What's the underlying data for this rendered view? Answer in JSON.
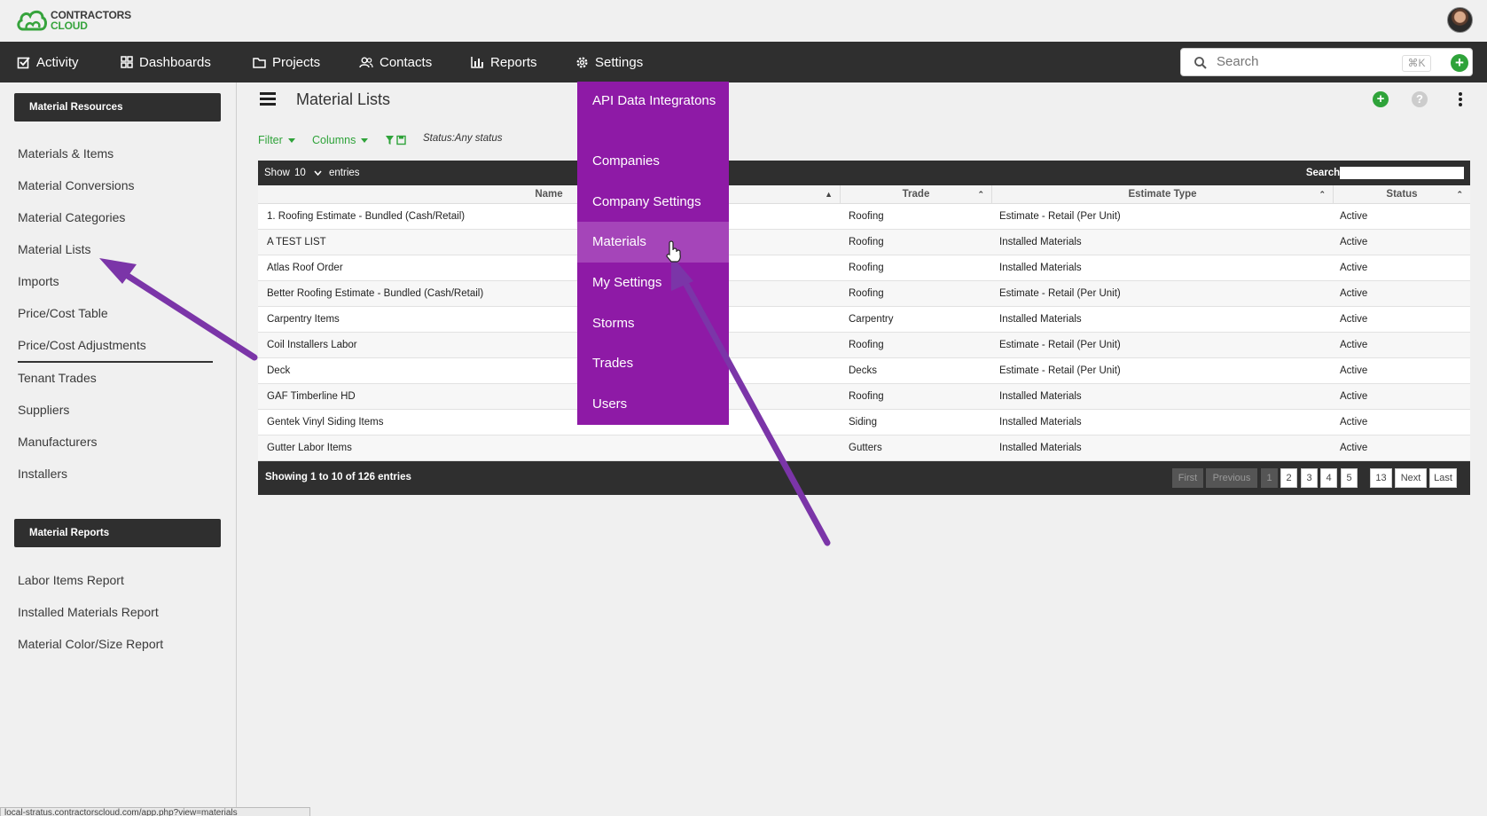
{
  "brand": {
    "line1": "CONTRACTORS",
    "line2": "CLOUD"
  },
  "nav": {
    "items": [
      {
        "label": "Activity",
        "icon": "checkbox-icon"
      },
      {
        "label": "Dashboards",
        "icon": "grid-icon"
      },
      {
        "label": "Projects",
        "icon": "folder-icon"
      },
      {
        "label": "Contacts",
        "icon": "people-icon"
      },
      {
        "label": "Reports",
        "icon": "bar-chart-icon"
      },
      {
        "label": "Settings",
        "icon": "gear-icon"
      }
    ],
    "search_placeholder": "Search",
    "shortcut": "⌘K"
  },
  "settings_menu": {
    "items": [
      "API Data Integratons",
      "Companies",
      "Company Settings",
      "Materials",
      "My Settings",
      "Storms",
      "Trades",
      "Users"
    ],
    "highlighted": "Materials"
  },
  "sidebar": {
    "resources_header": "Material Resources",
    "resources": [
      "Materials & Items",
      "Material Conversions",
      "Material Categories",
      "Material Lists",
      "Imports",
      "Price/Cost Table",
      "Price/Cost Adjustments"
    ],
    "other": [
      "Tenant Trades",
      "Suppliers",
      "Manufacturers",
      "Installers"
    ],
    "reports_header": "Material Reports",
    "reports": [
      "Labor Items Report",
      "Installed Materials Report",
      "Material Color/Size Report"
    ]
  },
  "page": {
    "title": "Material Lists",
    "filter_label": "Filter",
    "columns_label": "Columns",
    "status_filter": "Status:Any status"
  },
  "table": {
    "show_label": "Show",
    "page_size": "10",
    "entries_label": "entries",
    "search_label": "Search:",
    "columns": [
      "Name",
      "Trade",
      "Estimate Type",
      "Status"
    ],
    "rows": [
      [
        "1. Roofing Estimate - Bundled (Cash/Retail)",
        "Roofing",
        "Estimate - Retail (Per Unit)",
        "Active"
      ],
      [
        "A TEST LIST",
        "Roofing",
        "Installed Materials",
        "Active"
      ],
      [
        "Atlas Roof Order",
        "Roofing",
        "Installed Materials",
        "Active"
      ],
      [
        "Better Roofing Estimate - Bundled (Cash/Retail)",
        "Roofing",
        "Estimate - Retail (Per Unit)",
        "Active"
      ],
      [
        "Carpentry Items",
        "Carpentry",
        "Installed Materials",
        "Active"
      ],
      [
        "Coil Installers Labor",
        "Roofing",
        "Estimate - Retail (Per Unit)",
        "Active"
      ],
      [
        "Deck",
        "Decks",
        "Estimate - Retail (Per Unit)",
        "Active"
      ],
      [
        "GAF Timberline HD",
        "Roofing",
        "Installed Materials",
        "Active"
      ],
      [
        "Gentek Vinyl Siding Items",
        "Siding",
        "Installed Materials",
        "Active"
      ],
      [
        "Gutter Labor Items",
        "Gutters",
        "Installed Materials",
        "Active"
      ]
    ],
    "info": "Showing 1 to 10 of 126 entries",
    "pagination": {
      "first": "First",
      "previous": "Previous",
      "pages": [
        "1",
        "2",
        "3",
        "4",
        "5"
      ],
      "last_page": "13",
      "next": "Next",
      "last": "Last"
    }
  },
  "status_bar_url": "local-stratus.contractorscloud.com/app.php?view=materials",
  "colors": {
    "accent_green": "#2fa33a",
    "menu_purple": "#8e1aa6",
    "annotation_arrow": "#7b35a8"
  }
}
